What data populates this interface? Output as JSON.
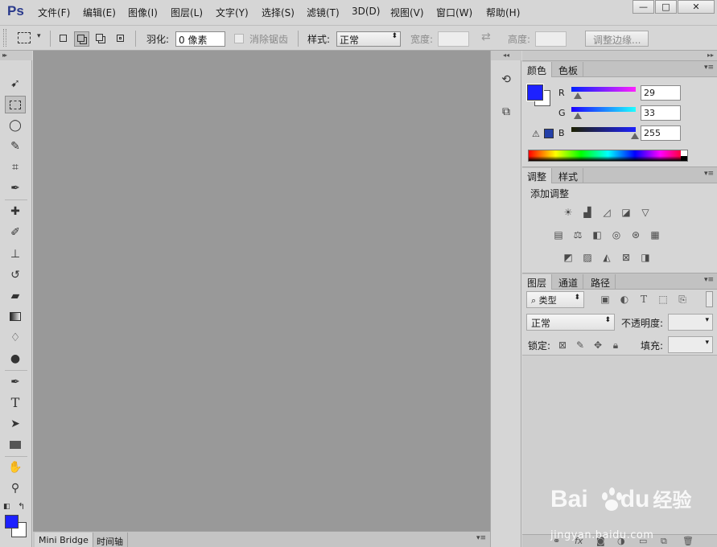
{
  "app": {
    "logo": "Ps"
  },
  "menubar": {
    "items": [
      "文件(F)",
      "编辑(E)",
      "图像(I)",
      "图层(L)",
      "文字(Y)",
      "选择(S)",
      "滤镜(T)",
      "3D(D)",
      "视图(V)",
      "窗口(W)",
      "帮助(H)"
    ],
    "window_controls": {
      "minimize": "—",
      "maximize": "□",
      "close": "✕"
    }
  },
  "options": {
    "feather_label": "羽化:",
    "feather_value": "0 像素",
    "antialias_label": "消除锯齿",
    "style_label": "样式:",
    "style_value": "正常",
    "width_label": "宽度:",
    "height_label": "高度:",
    "refine_edge_button": "调整边缘..."
  },
  "toolbox": {
    "tools": [
      "move-tool",
      "rectangular-marquee-tool",
      "lasso-tool",
      "quick-selection-tool",
      "crop-tool",
      "eyedropper-tool",
      "spot-healing-brush-tool",
      "brush-tool",
      "clone-stamp-tool",
      "history-brush-tool",
      "eraser-tool",
      "gradient-tool",
      "blur-tool",
      "dodge-tool",
      "pen-tool",
      "type-tool",
      "path-selection-tool",
      "rectangle-tool",
      "hand-tool",
      "zoom-tool"
    ],
    "selected_tool": "rectangular-marquee-tool",
    "foreground_color": "#1d21ff",
    "background_color": "#ffffff"
  },
  "bottombar": {
    "tabs": [
      "Mini Bridge",
      "时间轴"
    ]
  },
  "color_panel": {
    "tabs": [
      "颜色",
      "色板"
    ],
    "active_tab": "颜色",
    "r_label": "R",
    "r_value": "29",
    "g_label": "G",
    "g_value": "33",
    "b_label": "B",
    "b_value": "255",
    "swatch_color": "#1d21ff"
  },
  "adjustments_panel": {
    "tabs": [
      "调整",
      "样式"
    ],
    "active_tab": "调整",
    "heading": "添加调整"
  },
  "layers_panel": {
    "tabs": [
      "图层",
      "通道",
      "路径"
    ],
    "active_tab": "图层",
    "filter_kind": "类型",
    "blend_mode": "正常",
    "opacity_label": "不透明度:",
    "lock_label": "锁定:",
    "fill_label": "填充:"
  },
  "watermark": {
    "brand": "Bai",
    "brand2": "du",
    "brand3": "经验",
    "url": "jingyan.baidu.com"
  },
  "colors": {
    "chrome": "#d6d6d6",
    "canvas_bg": "#999999",
    "panel_header": "#c2c2c2",
    "logo": "#2a3a8c"
  }
}
